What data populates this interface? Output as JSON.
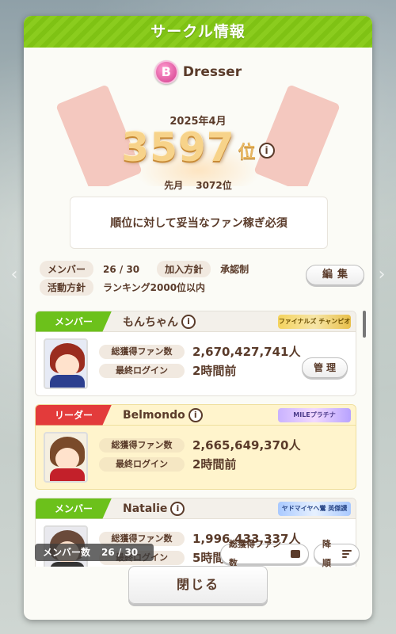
{
  "dialog": {
    "title": "サークル情報"
  },
  "circle": {
    "badge_letter": "B",
    "name": "Dresser",
    "month": "2025年4月",
    "rank": "3597",
    "rank_suffix": "位",
    "info_glyph": "i",
    "last_month_label": "先月",
    "last_month_rank": "3072位",
    "slogan": "順位に対して妥当なファン稼ぎ必須"
  },
  "meta": {
    "member_label": "メンバー",
    "member_count": "26 / 30",
    "join_label": "加入方針",
    "join_value": "承認制",
    "activity_label": "活動方針",
    "activity_value": "ランキング2000位以内",
    "edit_button": "編集"
  },
  "members": [
    {
      "role": "メンバー",
      "role_type": "member",
      "name": "もんちゃん",
      "title": "ファイナルズ チャンピオン",
      "title_style": "gold",
      "fans_label": "総獲得ファン数",
      "fans": "2,670,427,741人",
      "login_label": "最終ログイン",
      "login": "2時間前",
      "manage_button": "管理",
      "colors": {
        "hair": "#9b2d1f",
        "body": "#2c3f8f"
      }
    },
    {
      "role": "リーダー",
      "role_type": "leader",
      "name": "Belmondo",
      "title": "MILEプラチナ",
      "title_style": "purple",
      "fans_label": "総獲得ファン数",
      "fans": "2,665,649,370人",
      "login_label": "最終ログイン",
      "login": "2時間前",
      "colors": {
        "hair": "#7a4a2a",
        "body": "#c3202a"
      }
    },
    {
      "role": "メンバー",
      "role_type": "member",
      "name": "Natalie",
      "title": "ヤドマイヤへ鸞 英傑讃☆9",
      "title_style": "blue",
      "fans_label": "総獲得ファン数",
      "fans": "1,996,433,337人",
      "login_label": "最終ログイン",
      "login": "5時間前",
      "colors": {
        "hair": "#6a4a3a",
        "body": "#333333"
      }
    }
  ],
  "footer": {
    "count_label": "メンバー数",
    "count_value": "26 / 30",
    "sort_fans": "総獲得ファン数",
    "sort_order": "降順",
    "close": "閉じる"
  }
}
